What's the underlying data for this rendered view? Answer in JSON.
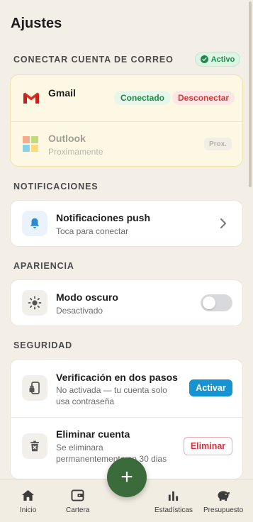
{
  "page": {
    "title": "Ajustes"
  },
  "email_section": {
    "label": "CONECTAR CUENTA DE CORREO",
    "status_badge": "Activo",
    "gmail": {
      "name": "Gmail",
      "connected_label": "Conectado",
      "disconnect_label": "Desconectar"
    },
    "outlook": {
      "name": "Outlook",
      "subtitle": "Proximamente",
      "badge": "Prox."
    }
  },
  "notifications_section": {
    "label": "NOTIFICACIONES",
    "push": {
      "title": "Notificaciones push",
      "subtitle": "Toca para conectar",
      "icon": "bell-icon"
    }
  },
  "appearance_section": {
    "label": "APARIENCIA",
    "dark_mode": {
      "title": "Modo oscuro",
      "subtitle": "Desactivado",
      "enabled": false,
      "icon": "sun-icon"
    }
  },
  "security_section": {
    "label": "SEGURIDAD",
    "two_factor": {
      "title": "Verificación en dos pasos",
      "subtitle_line1": "No activada — tu cuenta solo",
      "subtitle_line2": "usa contraseña",
      "button": "Activar",
      "icon": "phone-lock-icon"
    },
    "delete_account": {
      "title": "Eliminar cuenta",
      "subtitle_line1": "Se eliminara",
      "subtitle_line2": "permanentemente en 30 dias",
      "button": "Eliminar",
      "icon": "trash-icon"
    }
  },
  "bottom_nav": {
    "items": [
      {
        "label": "Inicio",
        "icon": "home-icon"
      },
      {
        "label": "Cartera",
        "icon": "wallet-icon"
      },
      {
        "label": "Estadísticas",
        "icon": "bar-chart-icon"
      },
      {
        "label": "Presupuesto",
        "icon": "piggy-bank-icon"
      }
    ],
    "fab_label": "+"
  },
  "colors": {
    "background": "#f4efe6",
    "accent_green": "#3b6b3a",
    "success": "#1f8a48",
    "danger": "#d33a3a",
    "primary_blue": "#1693d3"
  }
}
